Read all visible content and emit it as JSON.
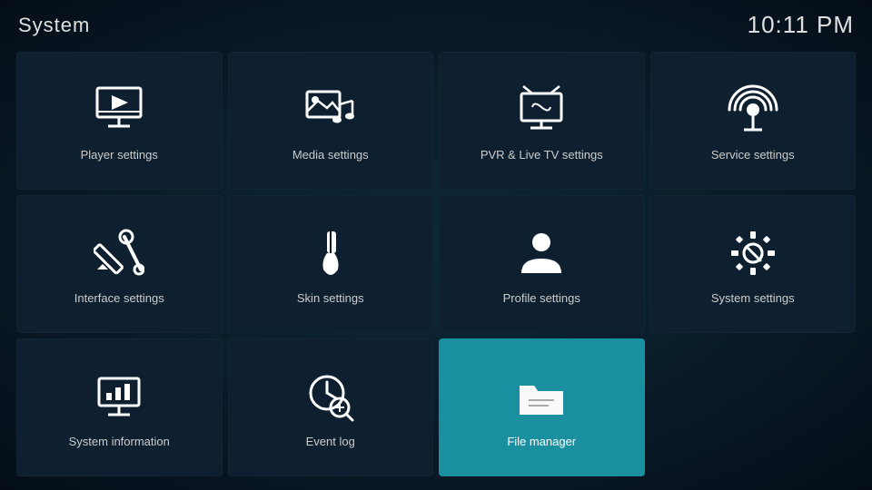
{
  "header": {
    "title": "System",
    "time": "10:11 PM"
  },
  "tiles": [
    {
      "id": "player-settings",
      "label": "Player settings",
      "icon": "player",
      "active": false
    },
    {
      "id": "media-settings",
      "label": "Media settings",
      "icon": "media",
      "active": false
    },
    {
      "id": "pvr-settings",
      "label": "PVR & Live TV settings",
      "icon": "pvr",
      "active": false
    },
    {
      "id": "service-settings",
      "label": "Service settings",
      "icon": "service",
      "active": false
    },
    {
      "id": "interface-settings",
      "label": "Interface settings",
      "icon": "interface",
      "active": false
    },
    {
      "id": "skin-settings",
      "label": "Skin settings",
      "icon": "skin",
      "active": false
    },
    {
      "id": "profile-settings",
      "label": "Profile settings",
      "icon": "profile",
      "active": false
    },
    {
      "id": "system-settings",
      "label": "System settings",
      "icon": "system",
      "active": false
    },
    {
      "id": "system-information",
      "label": "System information",
      "icon": "sysinfo",
      "active": false
    },
    {
      "id": "event-log",
      "label": "Event log",
      "icon": "eventlog",
      "active": false
    },
    {
      "id": "file-manager",
      "label": "File manager",
      "icon": "filemanager",
      "active": true
    }
  ]
}
